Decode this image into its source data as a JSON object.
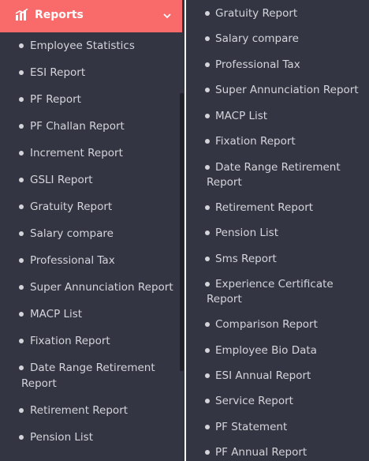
{
  "menu": {
    "title": "Reports",
    "icon": "bar-chart-icon",
    "expand_icon": "chevron-down-icon",
    "accent_color": "#f96a6a",
    "background_color": "#333542"
  },
  "left_items": [
    {
      "label": "Employee Statistics"
    },
    {
      "label": "ESI Report"
    },
    {
      "label": "PF Report"
    },
    {
      "label": "PF Challan Report"
    },
    {
      "label": "Increment Report"
    },
    {
      "label": "GSLI Report"
    },
    {
      "label": "Gratuity Report"
    },
    {
      "label": "Salary compare"
    },
    {
      "label": "Professional Tax"
    },
    {
      "label": "Super Annunciation Report"
    },
    {
      "label": "MACP List"
    },
    {
      "label": "Fixation Report"
    },
    {
      "label": "Date Range Retirement",
      "label2": "Report"
    },
    {
      "label": "Retirement Report"
    },
    {
      "label": "Pension List"
    }
  ],
  "right_items": [
    {
      "label": "Gratuity Report"
    },
    {
      "label": "Salary compare"
    },
    {
      "label": "Professional Tax"
    },
    {
      "label": "Super Annunciation Report"
    },
    {
      "label": "MACP List"
    },
    {
      "label": "Fixation Report"
    },
    {
      "label": "Date Range Retirement",
      "label2": "Report"
    },
    {
      "label": "Retirement Report"
    },
    {
      "label": "Pension List"
    },
    {
      "label": "Sms Report"
    },
    {
      "label": "Experience Certificate",
      "label2": "Report"
    },
    {
      "label": "Comparison Report"
    },
    {
      "label": "Employee Bio Data"
    },
    {
      "label": "ESI Annual Report"
    },
    {
      "label": "Service Report"
    },
    {
      "label": "PF Statement"
    },
    {
      "label": "PF Annual Report"
    }
  ]
}
